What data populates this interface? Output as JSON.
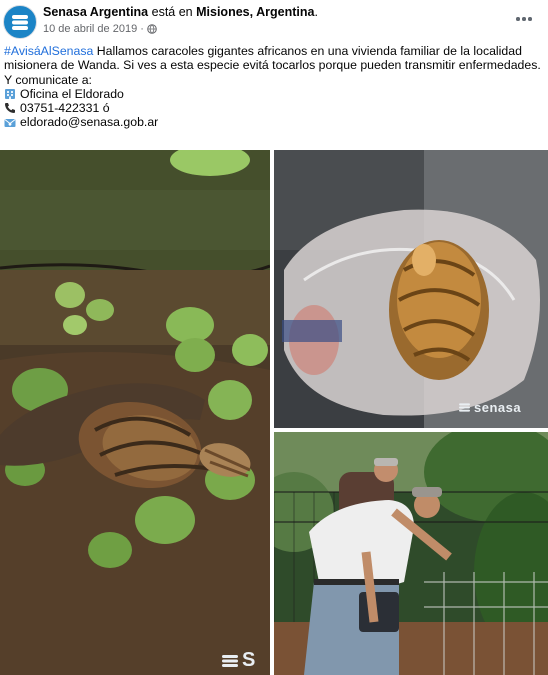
{
  "post": {
    "author": "Senasa Argentina",
    "verb": "está en",
    "location": "Misiones, Argentina",
    "location_suffix": ".",
    "date": "10 de abril de 2019",
    "hashtag": "#AvisáAlSenasa",
    "body": " Hallamos caracoles gigantes africanos en una vivienda familiar de la localidad misionera de Wanda. Si ves a esta especie evitá tocarlos porque pueden transmitir enfermedades.",
    "contact_intro": "Y comunicate a:",
    "office": "Oficina el Eldorado",
    "phone": "03751-422331 ó",
    "email": "eldorado@senasa.gob.ar"
  },
  "photos": {
    "watermark_full": "senasa",
    "watermark_partial": "S"
  },
  "icons": {
    "office": "building-icon",
    "phone": "telephone-icon",
    "email": "envelope-icon",
    "privacy": "globe-icon",
    "menu": "more-options-icon"
  },
  "colors": {
    "hashtag": "#216fdb",
    "brand": "#1b84c6",
    "secondary_text": "#65676b"
  }
}
